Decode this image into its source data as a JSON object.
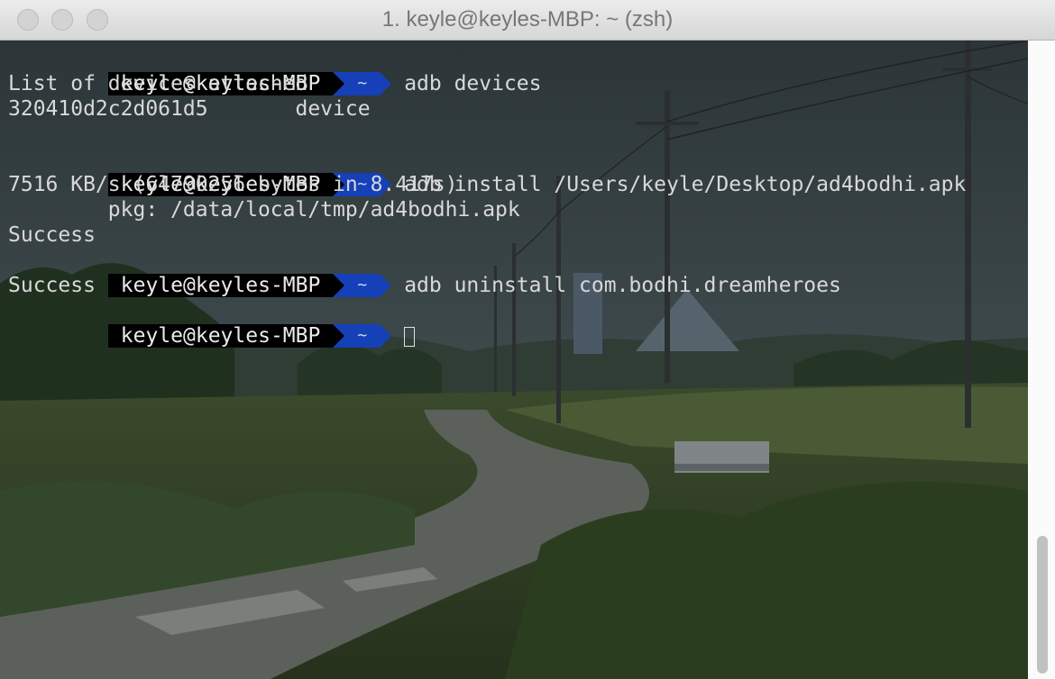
{
  "window": {
    "title": "1. keyle@keyles-MBP: ~ (zsh)"
  },
  "prompt": {
    "user": "keyle@keyles-MBP",
    "dir": "~"
  },
  "terminal": {
    "cmd1": "adb devices",
    "out1": "List of devices attached",
    "out2": "320410d2c2d061d5       device",
    "cmd2": "adb install /Users/keyle/Desktop/ad4bodhi.apk",
    "out3": "7516 KB/s (64790256 bytes in 8.417s)",
    "out4": "        pkg: /data/local/tmp/ad4bodhi.apk",
    "out5": "Success",
    "cmd3": "adb uninstall com.bodhi.dreamheroes",
    "out6": "Success"
  },
  "colors": {
    "prompt_user_bg": "#000000",
    "prompt_dir_bg": "#1540b8",
    "text": "#d9d9d9"
  }
}
